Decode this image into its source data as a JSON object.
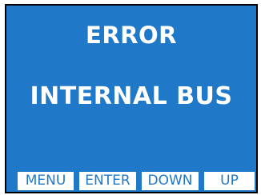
{
  "display": {
    "title": "ERROR",
    "message": "INTERNAL BUS"
  },
  "softkeys": {
    "menu": "MENU",
    "enter": "ENTER",
    "down": "DOWN",
    "up": "UP"
  },
  "colors": {
    "screen_background": "#1f78c8",
    "text": "#ffffff",
    "softkey_background": "#ffffff",
    "softkey_text": "#1f78c8",
    "border": "#000000"
  }
}
